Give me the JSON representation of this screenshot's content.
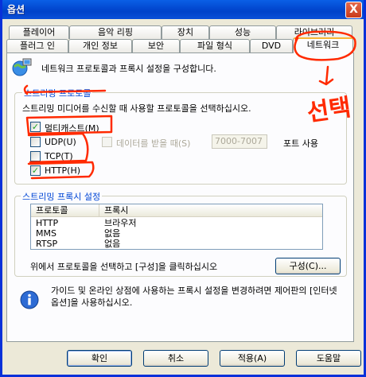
{
  "window": {
    "title": "옵션",
    "close_glyph": "X"
  },
  "tabs_row1": [
    "플레이어",
    "음악 리핑",
    "장치",
    "성능",
    "라이브러리"
  ],
  "tabs_row2": [
    "플러그 인",
    "개인 정보",
    "보안",
    "파일 형식",
    "DVD",
    "네트워크"
  ],
  "active_tab": "네트워크",
  "intro_text": "네트워크 프로토콜과 프록시 설정을 구성합니다.",
  "streaming_protocols": {
    "group_title": "스트리밍 프로토콜",
    "description": "스트리밍 미디어를 수신할 때 사용할 프로토콜을 선택하십시오.",
    "multicast": {
      "label": "멀티캐스트(M)",
      "checked": true
    },
    "udp": {
      "label": "UDP(U)",
      "checked": false
    },
    "tcp": {
      "label": "TCP(T)",
      "checked": false
    },
    "http": {
      "label": "HTTP(H)",
      "checked": true
    },
    "receive_ports": {
      "label": "데이터를 받을 때(S)",
      "value": "7000-7007",
      "suffix": "포트 사용"
    }
  },
  "proxy": {
    "group_title": "스트리밍 프록시 설정",
    "columns": [
      "프로토콜",
      "프록시"
    ],
    "rows": [
      {
        "protocol": "HTTP",
        "proxy": "브라우저"
      },
      {
        "protocol": "MMS",
        "proxy": "없음"
      },
      {
        "protocol": "RTSP",
        "proxy": "없음"
      }
    ],
    "hint": "위에서 프로토콜을 선택하고 [구성]을 클릭하십시오",
    "configure_button": "구성(C)..."
  },
  "info_text": "가이드 및 온라인 상점에 사용하는 프록시 설정을 변경하려면 제어판의 [인터넷 옵션]을 사용하십시오.",
  "buttons": {
    "ok": "확인",
    "cancel": "취소",
    "apply": "적용(A)",
    "help": "도움말"
  },
  "annotation": {
    "color": "#ff2a00",
    "text": "선택"
  },
  "colors": {
    "titlebar": "#0041c9",
    "group_title": "#0046d5",
    "active_tab_highlight": "#f8b535"
  }
}
